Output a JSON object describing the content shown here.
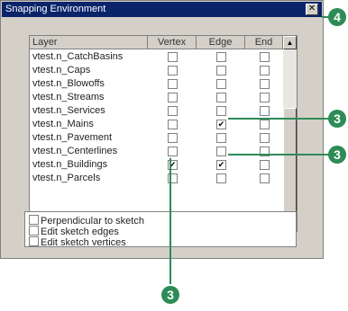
{
  "window": {
    "title": "Snapping Environment",
    "close_glyph": "✕"
  },
  "columns": [
    "Layer",
    "Vertex",
    "Edge",
    "End"
  ],
  "rows": [
    {
      "name": "vtest.n_CatchBasins",
      "vertex": false,
      "edge": false,
      "end": false
    },
    {
      "name": "vtest.n_Caps",
      "vertex": false,
      "edge": false,
      "end": false
    },
    {
      "name": "vtest.n_Blowoffs",
      "vertex": false,
      "edge": false,
      "end": false
    },
    {
      "name": "vtest.n_Streams",
      "vertex": false,
      "edge": false,
      "end": false
    },
    {
      "name": "vtest.n_Services",
      "vertex": false,
      "edge": false,
      "end": false
    },
    {
      "name": "vtest.n_Mains",
      "vertex": false,
      "edge": true,
      "end": false
    },
    {
      "name": "vtest.n_Pavement",
      "vertex": false,
      "edge": false,
      "end": false
    },
    {
      "name": "vtest.n_Centerlines",
      "vertex": false,
      "edge": false,
      "end": false
    },
    {
      "name": "vtest.n_Buildings",
      "vertex": true,
      "edge": true,
      "end": false
    },
    {
      "name": "vtest.n_Parcels",
      "vertex": false,
      "edge": false,
      "end": false
    }
  ],
  "options": [
    {
      "label": "Perpendicular to sketch",
      "checked": false
    },
    {
      "label": "Edit sketch edges",
      "checked": false
    },
    {
      "label": "Edit sketch vertices",
      "checked": false
    }
  ],
  "callouts": [
    {
      "id": "callout-close",
      "label": "4"
    },
    {
      "id": "callout-mains-edge",
      "label": "3"
    },
    {
      "id": "callout-buildings-edge",
      "label": "3"
    },
    {
      "id": "callout-buildings-vertex",
      "label": "3"
    }
  ],
  "colors": {
    "callout": "#2e8b57",
    "titlebar": "#0a246a"
  },
  "icons": {
    "check": "✔",
    "scroll_up": "▲",
    "scroll_down": "▼"
  }
}
